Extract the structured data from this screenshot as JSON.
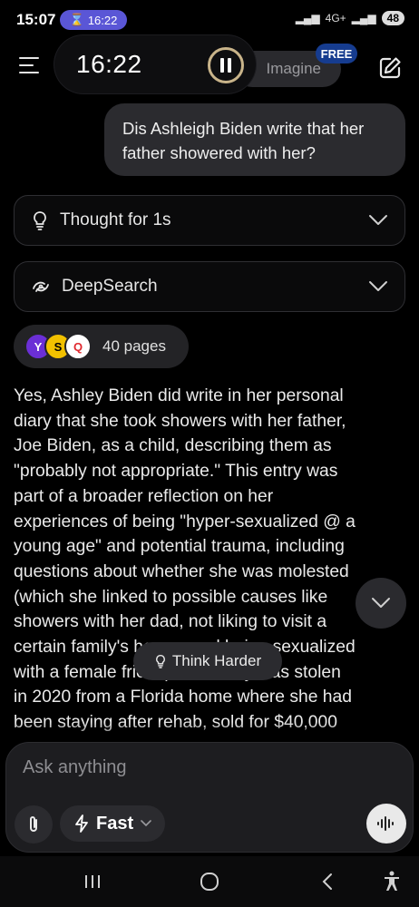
{
  "status_bar": {
    "time": "15:07",
    "timer_badge": "16:22",
    "network": "4G+",
    "battery": "48"
  },
  "header": {
    "imagine_label": "Imagine",
    "free_badge": "FREE",
    "menu_icon": "hamburger-icon",
    "new_chat_icon": "edit-icon"
  },
  "floating_timer": {
    "time": "16:22"
  },
  "conversation": {
    "user_message": "Dis Ashleigh Biden write that her father showered with her?",
    "thought_label": "Thought for 1s",
    "deepsearch_label": "DeepSearch",
    "sources": {
      "count_label": "40 pages",
      "favicons": [
        "Y",
        "S",
        "Q"
      ]
    },
    "response_lines": [
      "Yes, Ashley Biden did write in her personal",
      "diary that she took showers with her father,",
      "Joe Biden, as a child, describing them as",
      "\"probably not appropriate.\" This entry was",
      "part of a broader reflection on her",
      "experiences of being \"hyper-sexualized @ a",
      "young age\" and potential trauma, including",
      "questions about whether she was molested",
      "(which she linked to possible causes like",
      "showers with her dad, not liking to visit a",
      "certain family's house, and being sexualized",
      "with a female friend). The diary was stolen",
      "in 2020 from a Florida home where she had",
      "been staying after rehab, sold for $40,000"
    ],
    "think_harder_label": "Think Harder"
  },
  "composer": {
    "placeholder": "Ask anything",
    "mode_label": "Fast"
  },
  "colors": {
    "background": "#000000",
    "bubble": "#2b2b2f",
    "free_badge": "#163c8f",
    "timer_pill": "#5a56d6"
  }
}
